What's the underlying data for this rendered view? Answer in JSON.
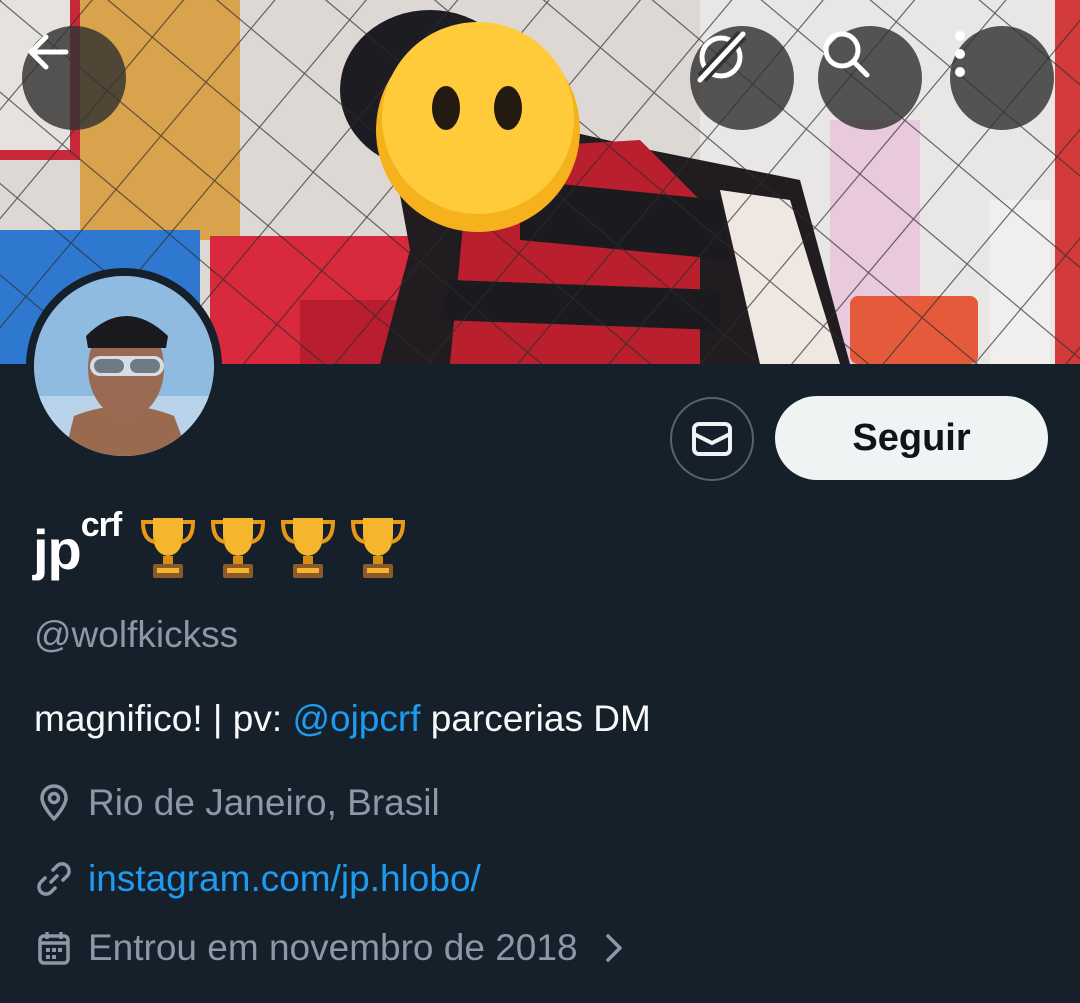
{
  "header": {
    "back_icon": "arrow-left-icon",
    "grok_icon": "grok-slash-icon",
    "search_icon": "search-icon",
    "more_icon": "more-vertical-icon"
  },
  "profile": {
    "name": "jp",
    "name_superscript": "crf",
    "name_emoji": [
      "🏆",
      "🏆",
      "🏆",
      "🏆"
    ],
    "handle": "@wolfkickss",
    "bio_prefix": "magnifico! | pv: ",
    "bio_mention": "@ojpcrf",
    "bio_suffix": " parcerias DM",
    "location": "Rio de Janeiro, Brasil",
    "website": "instagram.com/jp.hlobo/",
    "joined": "Entrou em novembro de 2018"
  },
  "actions": {
    "message_icon": "envelope-icon",
    "follow_label": "Seguir"
  },
  "colors": {
    "background": "#15202b",
    "accent": "#1d9bf0",
    "secondary_text": "#8b98a5",
    "follow_bg": "#eff3f4"
  }
}
